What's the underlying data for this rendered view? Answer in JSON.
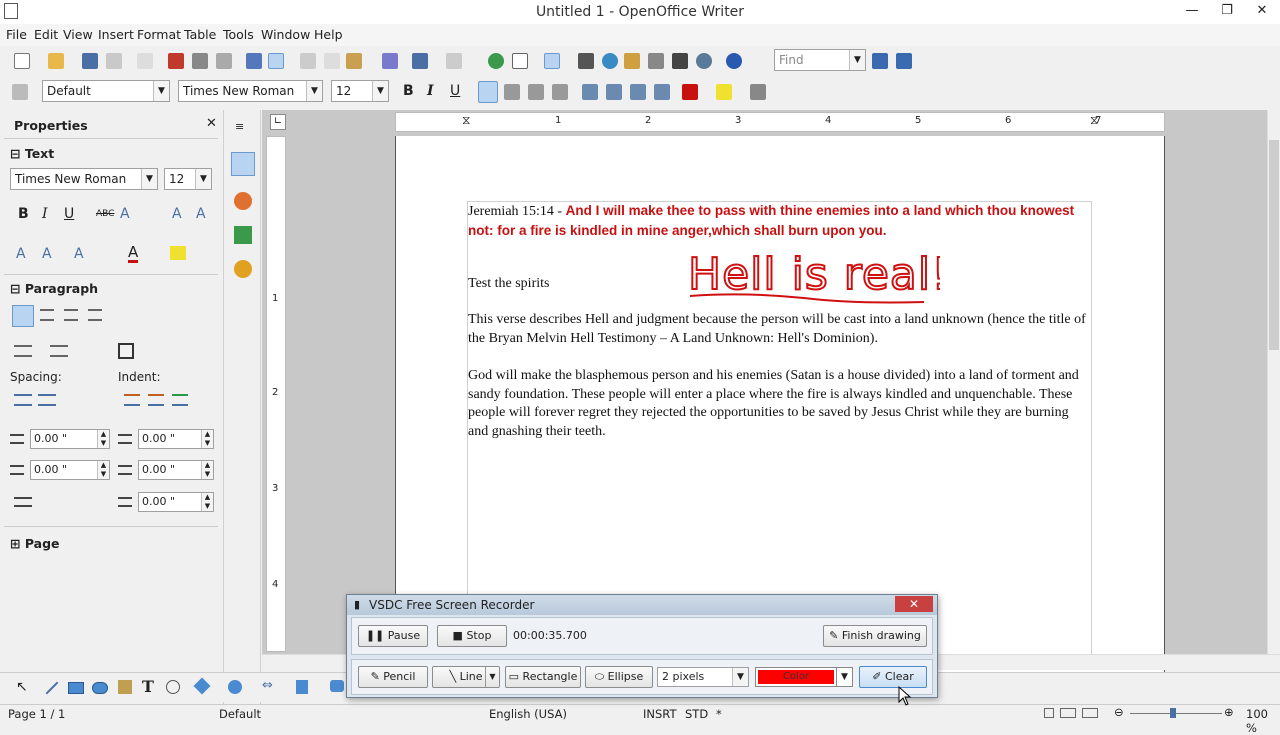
{
  "window": {
    "title": "Untitled 1 - OpenOffice Writer",
    "min": "—",
    "max": "❐",
    "close": "✕"
  },
  "menu": [
    "File",
    "Edit",
    "View",
    "Insert",
    "Format",
    "Table",
    "Tools",
    "Window",
    "Help"
  ],
  "find": {
    "placeholder": "Find"
  },
  "format": {
    "style": "Default",
    "font": "Times New Roman",
    "size": "12",
    "bold": "B",
    "italic": "I",
    "underline": "U"
  },
  "sidebar": {
    "title": "Properties",
    "close": "✕",
    "text_section": "Text",
    "font": "Times New Roman",
    "size": "12",
    "paragraph_section": "Paragraph",
    "spacing_label": "Spacing:",
    "indent_label": "Indent:",
    "values": [
      "0.00 \"",
      "0.00 \"",
      "0.00 \"",
      "0.00 \"",
      "0.00 \""
    ],
    "page_section": "Page"
  },
  "document": {
    "p1_prefix": "Jeremiah 15:14 - ",
    "p1_red": "And I will make thee to pass with thine enemies into a land which thou knowest not: for a fire is kindled in mine anger,which shall burn upon you.",
    "p2": "Test the spirits",
    "handwriting": "Hell is real!",
    "p3": "This verse describes Hell and judgment because the person will be cast into a land unknown (hence the title of the Bryan Melvin Hell Testimony – A Land Unknown: Hell's Dominion).",
    "p4": "God will make the blasphemous person and his enemies (Satan is a house divided) into a land of torment and sandy foundation. These people will enter a place where the fire is always kindled and unquenchable. These people will forever regret they rejected the opportunities to be saved by Jesus Christ while they are burning and gnashing their teeth."
  },
  "ruler": {
    "h": [
      "1",
      "2",
      "3",
      "4",
      "5",
      "6",
      "7"
    ],
    "v": [
      "1",
      "2",
      "3",
      "4"
    ]
  },
  "recorder": {
    "title": "VSDC Free Screen Recorder",
    "pause": "Pause",
    "stop": "Stop",
    "time": "00:00:35.700",
    "finish": "Finish drawing",
    "pencil": "Pencil",
    "line": "Line",
    "rectangle": "Rectangle",
    "ellipse": "Ellipse",
    "thickness": "2 pixels",
    "color": "Color",
    "color_hex": "#ff0000",
    "clear": "Clear"
  },
  "status": {
    "page": "Page 1 / 1",
    "style": "Default",
    "lang": "English (USA)",
    "insrt": "INSRT",
    "std": "STD",
    "star": "*",
    "zoom": "100 %"
  }
}
